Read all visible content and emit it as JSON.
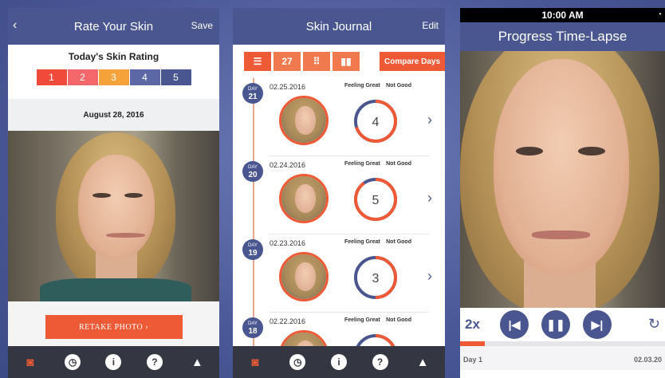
{
  "screen1": {
    "nav": {
      "back": "‹",
      "title": "Rate Your Skin",
      "save": "Save"
    },
    "rating_title": "Today's Skin Rating",
    "rating_scale": [
      {
        "label": "1",
        "color": "#ef4a3a"
      },
      {
        "label": "2",
        "color": "#f4676a"
      },
      {
        "label": "3",
        "color": "#f6a23b"
      },
      {
        "label": "4",
        "color": "#5b68a5"
      },
      {
        "label": "5",
        "color": "#49568f"
      }
    ],
    "selected_rating": "3",
    "date": "August 28, 2016",
    "retake": "RETAKE PHOTO ›"
  },
  "screen2": {
    "nav": {
      "title": "Skin Journal",
      "edit": "Edit"
    },
    "tools": [
      {
        "icon": "list-icon",
        "glyph": "☰"
      },
      {
        "icon": "calendar-icon",
        "glyph": "27"
      },
      {
        "icon": "grid-icon",
        "glyph": "⠿"
      },
      {
        "icon": "bar-chart-icon",
        "glyph": "▮▮"
      }
    ],
    "compare": "Compare Days",
    "scale_left": "Feeling Great",
    "scale_right": "Not Good",
    "day_word": "DAY",
    "entries": [
      {
        "day": "21",
        "date": "02.25.2016",
        "rating": "4",
        "fraction": 0.7
      },
      {
        "day": "20",
        "date": "02.24.2016",
        "rating": "5",
        "fraction": 0.9
      },
      {
        "day": "19",
        "date": "02.23.2016",
        "rating": "3",
        "fraction": 0.5
      },
      {
        "day": "18",
        "date": "02.22.2016",
        "rating": "",
        "fraction": 0.5
      }
    ],
    "accent_color": "#ef5a36",
    "secondary_color": "#49568f"
  },
  "screen3": {
    "status_time": "10:00 AM",
    "title": "Progress Time-Lapse",
    "speed": "2x",
    "progress_fraction": 0.12,
    "start_label": "Day 1",
    "end_label": "02.03.20"
  },
  "tabbar": [
    "camera-icon",
    "history-icon",
    "info-icon",
    "help-icon",
    "alert-icon"
  ]
}
